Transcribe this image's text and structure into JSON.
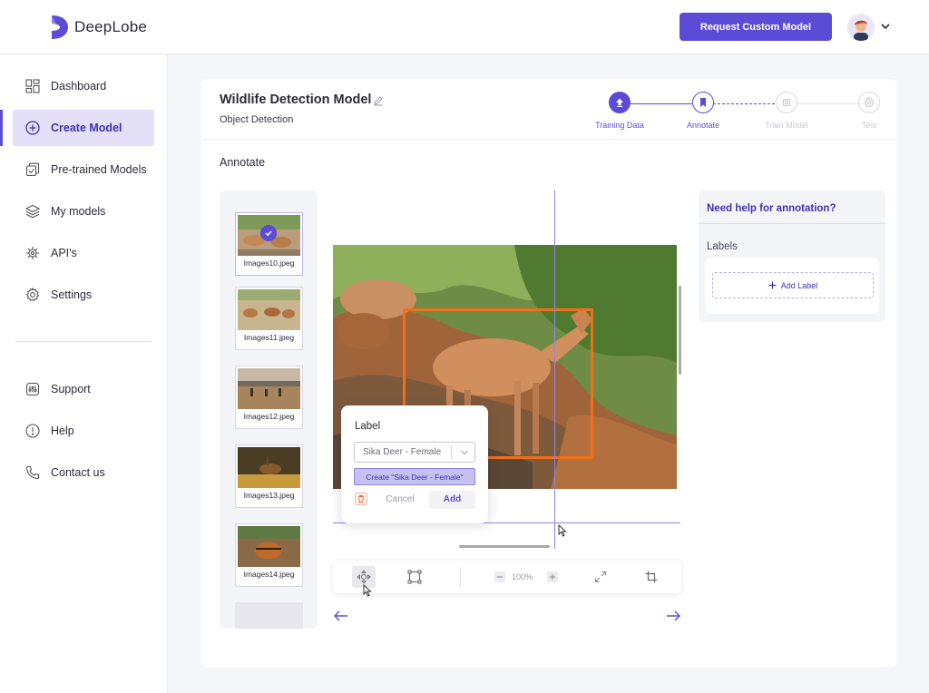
{
  "app": {
    "brand": "DeepLobe",
    "request_button": "Request Custom Model"
  },
  "sidebar": {
    "items": [
      {
        "label": "Dashboard",
        "icon": "dashboard-icon",
        "active": false
      },
      {
        "label": "Create Model",
        "icon": "plus-circle-icon",
        "active": true
      },
      {
        "label": "Pre-trained Models",
        "icon": "pretrained-icon",
        "active": false
      },
      {
        "label": "My models",
        "icon": "layers-icon",
        "active": false
      },
      {
        "label": "API's",
        "icon": "api-icon",
        "active": false
      },
      {
        "label": "Settings",
        "icon": "gear-icon",
        "active": false
      }
    ],
    "secondary": [
      {
        "label": "Support",
        "icon": "support-icon"
      },
      {
        "label": "Help",
        "icon": "help-icon"
      },
      {
        "label": "Contact us",
        "icon": "phone-icon"
      }
    ]
  },
  "model": {
    "title": "Wildlife Detection Model",
    "subtitle": "Object Detection"
  },
  "stepper": {
    "steps": [
      {
        "label": "Training Data",
        "state": "done"
      },
      {
        "label": "Annotate",
        "state": "current"
      },
      {
        "label": "Train Model",
        "state": "pending"
      },
      {
        "label": "Test",
        "state": "pending"
      }
    ]
  },
  "section_title": "Annotate",
  "thumbnails": [
    {
      "label": "Images10.jpeg",
      "selected": true
    },
    {
      "label": "Images11.jpeg",
      "selected": false
    },
    {
      "label": "Images12.jpeg",
      "selected": false
    },
    {
      "label": "Images13.jpeg",
      "selected": false
    },
    {
      "label": "Images14.jpeg",
      "selected": false
    }
  ],
  "label_popup": {
    "title": "Label",
    "input_value": "Sika Deer - Female",
    "create_option": "Create \"Sika Deer - Female\"",
    "cancel": "Cancel",
    "add": "Add"
  },
  "toolbar": {
    "zoom": "100%"
  },
  "help_panel": {
    "title": "Need help for annotation?",
    "labels_heading": "Labels",
    "add_label": "Add Label"
  },
  "colors": {
    "accent": "#5b4bd6",
    "bbox": "#f26f1a",
    "accent_light": "#e3e0f8"
  }
}
